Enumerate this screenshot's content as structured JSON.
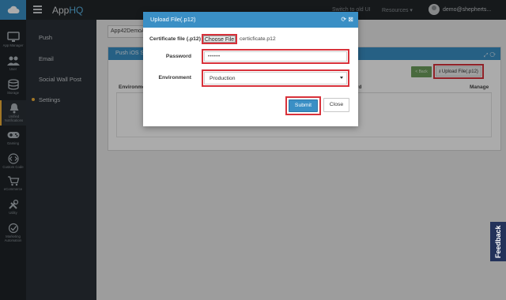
{
  "topbar": {
    "app_title_prefix": "App",
    "app_title_suffix": "HQ",
    "switch_link": "Switch to old UI",
    "resources_label": "Resources",
    "user_email": "demo@shepherts...",
    "logo_icon": "cloud-icon"
  },
  "iconnav": {
    "items": [
      {
        "label": "App Manager",
        "icon": "monitor-icon"
      },
      {
        "label": "User",
        "icon": "users-icon"
      },
      {
        "label": "Storage",
        "icon": "database-icon"
      },
      {
        "label": "Unified Notifications",
        "icon": "bell-icon"
      },
      {
        "label": "Gaming",
        "icon": "gamepad-icon"
      },
      {
        "label": "Custom Code",
        "icon": "code-icon"
      },
      {
        "label": "eCommerce",
        "icon": "cart-icon"
      },
      {
        "label": "Utility",
        "icon": "tools-icon"
      },
      {
        "label": "Marketing Automation",
        "icon": "marketing-icon"
      }
    ]
  },
  "subnav": {
    "items": [
      {
        "label": "Push"
      },
      {
        "label": "Email"
      },
      {
        "label": "Social Wall Post"
      },
      {
        "label": "Settings"
      }
    ]
  },
  "main": {
    "app_select_value": "App42DemoAp",
    "panel_title": "Push iOS Se",
    "back_label": "< Back",
    "upload_label": "Upload File(.p12)",
    "table_headers": [
      "Environme",
      "rd",
      "Manage"
    ]
  },
  "modal": {
    "title": "Upload File(.p12)",
    "certificate_label": "Certificate file (.p12)",
    "choose_file_label": "Choose File",
    "file_name": "certicficate.p12",
    "password_label": "Password",
    "password_value": "••••••",
    "environment_label": "Environment",
    "environment_value": "Production",
    "submit_label": "Submit",
    "close_label": "Close"
  },
  "feedback_label": "Feedback",
  "colors": {
    "accent": "#3a8fc5",
    "highlight": "#d8323b",
    "sidebar_dark": "#1e2328",
    "active_marker": "#f0b13a"
  }
}
